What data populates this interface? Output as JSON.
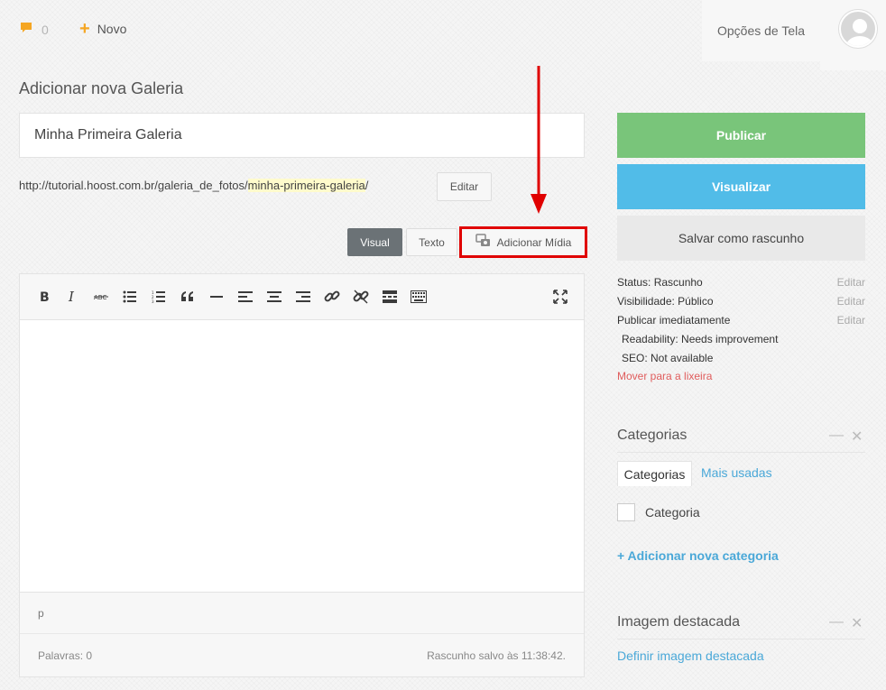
{
  "topbar": {
    "comments_count": "0",
    "new_label": "Novo",
    "screen_options_label": "Opções de Tela"
  },
  "editor_page": {
    "title": "Adicionar nova Galeria",
    "post_title_value": "Minha Primeira Galeria",
    "permalink_base": "http://tutorial.hoost.com.br/galeria_de_fotos/",
    "permalink_slug": "minha-primeira-galeria",
    "permalink_suffix": "/",
    "edit_permalink_label": "Editar",
    "tab_visual": "Visual",
    "tab_text": "Texto",
    "add_media_label": "Adicionar Mídia",
    "path_label": "p",
    "word_count": "Palavras: 0",
    "autosave_status": "Rascunho salvo às 11:38:42."
  },
  "publish_box": {
    "publish_label": "Publicar",
    "preview_label": "Visualizar",
    "save_draft_label": "Salvar como rascunho",
    "status": "Status: Rascunho",
    "visibility": "Visibilidade: Público",
    "schedule": "Publicar imediatamente",
    "edit_label": "Editar",
    "readability": "Readability: Needs improvement",
    "seo": "SEO: Not available",
    "trash_label": "Mover para a lixeira"
  },
  "categories_box": {
    "title": "Categorias",
    "tab_all": "Categorias",
    "tab_popular": "Mais usadas",
    "items": [
      {
        "label": "Categoria",
        "checked": false
      }
    ],
    "add_new_label": "+ Adicionar nova categoria"
  },
  "featured_image_box": {
    "title": "Imagem destacada",
    "set_label": "Definir imagem destacada"
  },
  "colors": {
    "publish": "#79c57a",
    "preview": "#51bce8",
    "highlight_box": "#e00000",
    "link": "#4aa8d8",
    "trash": "#e05c5c"
  }
}
